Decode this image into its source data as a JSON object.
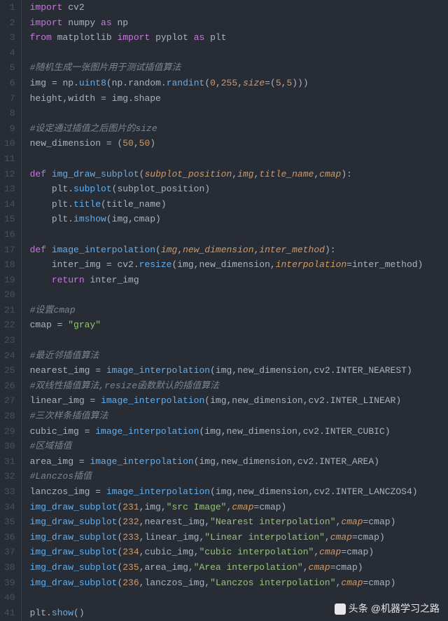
{
  "lines": [
    {
      "n": "1",
      "segs": [
        {
          "t": "import",
          "c": "kw"
        },
        {
          "t": " cv2",
          "c": "def"
        }
      ]
    },
    {
      "n": "2",
      "segs": [
        {
          "t": "import",
          "c": "kw"
        },
        {
          "t": " numpy ",
          "c": "def"
        },
        {
          "t": "as",
          "c": "kw"
        },
        {
          "t": " np",
          "c": "def"
        }
      ]
    },
    {
      "n": "3",
      "segs": [
        {
          "t": "from",
          "c": "kw"
        },
        {
          "t": " matplotlib ",
          "c": "def"
        },
        {
          "t": "import",
          "c": "kw"
        },
        {
          "t": " pyplot ",
          "c": "def"
        },
        {
          "t": "as",
          "c": "kw"
        },
        {
          "t": " plt",
          "c": "def"
        }
      ]
    },
    {
      "n": "4",
      "segs": []
    },
    {
      "n": "5",
      "segs": [
        {
          "t": "#随机生成一张图片用于测试插值算法",
          "c": "cmt"
        }
      ]
    },
    {
      "n": "6",
      "segs": [
        {
          "t": "img ",
          "c": "def"
        },
        {
          "t": "=",
          "c": "op"
        },
        {
          "t": " np.",
          "c": "def"
        },
        {
          "t": "uint8",
          "c": "fn"
        },
        {
          "t": "(np.random.",
          "c": "def"
        },
        {
          "t": "randint",
          "c": "fn"
        },
        {
          "t": "(",
          "c": "def"
        },
        {
          "t": "0",
          "c": "num"
        },
        {
          "t": ",",
          "c": "def"
        },
        {
          "t": "255",
          "c": "num"
        },
        {
          "t": ",",
          "c": "def"
        },
        {
          "t": "size",
          "c": "param"
        },
        {
          "t": "=",
          "c": "op"
        },
        {
          "t": "(",
          "c": "def"
        },
        {
          "t": "5",
          "c": "num"
        },
        {
          "t": ",",
          "c": "def"
        },
        {
          "t": "5",
          "c": "num"
        },
        {
          "t": ")))",
          "c": "def"
        }
      ]
    },
    {
      "n": "7",
      "segs": [
        {
          "t": "height,width ",
          "c": "def"
        },
        {
          "t": "=",
          "c": "op"
        },
        {
          "t": " img.shape",
          "c": "def"
        }
      ]
    },
    {
      "n": "8",
      "segs": []
    },
    {
      "n": "9",
      "segs": [
        {
          "t": "#设定通过插值之后图片的size",
          "c": "cmt"
        }
      ]
    },
    {
      "n": "10",
      "segs": [
        {
          "t": "new_dimension ",
          "c": "def"
        },
        {
          "t": "=",
          "c": "op"
        },
        {
          "t": " (",
          "c": "def"
        },
        {
          "t": "50",
          "c": "num"
        },
        {
          "t": ",",
          "c": "def"
        },
        {
          "t": "50",
          "c": "num"
        },
        {
          "t": ")",
          "c": "def"
        }
      ]
    },
    {
      "n": "11",
      "segs": []
    },
    {
      "n": "12",
      "segs": [
        {
          "t": "def",
          "c": "kw"
        },
        {
          "t": " ",
          "c": "def"
        },
        {
          "t": "img_draw_subplot",
          "c": "fn"
        },
        {
          "t": "(",
          "c": "def"
        },
        {
          "t": "subplot_position",
          "c": "param"
        },
        {
          "t": ",",
          "c": "def"
        },
        {
          "t": "img",
          "c": "param"
        },
        {
          "t": ",",
          "c": "def"
        },
        {
          "t": "title_name",
          "c": "param"
        },
        {
          "t": ",",
          "c": "def"
        },
        {
          "t": "cmap",
          "c": "param"
        },
        {
          "t": "):",
          "c": "def"
        }
      ]
    },
    {
      "n": "13",
      "segs": [
        {
          "t": "    plt.",
          "c": "def"
        },
        {
          "t": "subplot",
          "c": "fn"
        },
        {
          "t": "(subplot_position)",
          "c": "def"
        }
      ]
    },
    {
      "n": "14",
      "segs": [
        {
          "t": "    plt.",
          "c": "def"
        },
        {
          "t": "title",
          "c": "fn"
        },
        {
          "t": "(title_name)",
          "c": "def"
        }
      ]
    },
    {
      "n": "15",
      "segs": [
        {
          "t": "    plt.",
          "c": "def"
        },
        {
          "t": "imshow",
          "c": "fn"
        },
        {
          "t": "(img,cmap)",
          "c": "def"
        }
      ]
    },
    {
      "n": "16",
      "segs": []
    },
    {
      "n": "17",
      "segs": [
        {
          "t": "def",
          "c": "kw"
        },
        {
          "t": " ",
          "c": "def"
        },
        {
          "t": "image_interpolation",
          "c": "fn"
        },
        {
          "t": "(",
          "c": "def"
        },
        {
          "t": "img",
          "c": "param"
        },
        {
          "t": ",",
          "c": "def"
        },
        {
          "t": "new_dimension",
          "c": "param"
        },
        {
          "t": ",",
          "c": "def"
        },
        {
          "t": "inter_method",
          "c": "param"
        },
        {
          "t": "):",
          "c": "def"
        }
      ]
    },
    {
      "n": "18",
      "segs": [
        {
          "t": "    inter_img ",
          "c": "def"
        },
        {
          "t": "=",
          "c": "op"
        },
        {
          "t": " cv2.",
          "c": "def"
        },
        {
          "t": "resize",
          "c": "fn"
        },
        {
          "t": "(img,new_dimension,",
          "c": "def"
        },
        {
          "t": "interpolation",
          "c": "param"
        },
        {
          "t": "=",
          "c": "op"
        },
        {
          "t": "inter_method)",
          "c": "def"
        }
      ]
    },
    {
      "n": "19",
      "segs": [
        {
          "t": "    ",
          "c": "def"
        },
        {
          "t": "return",
          "c": "kw"
        },
        {
          "t": " inter_img",
          "c": "def"
        }
      ]
    },
    {
      "n": "20",
      "segs": []
    },
    {
      "n": "21",
      "segs": [
        {
          "t": "#设置cmap",
          "c": "cmt"
        }
      ]
    },
    {
      "n": "22",
      "segs": [
        {
          "t": "cmap ",
          "c": "def"
        },
        {
          "t": "=",
          "c": "op"
        },
        {
          "t": " ",
          "c": "def"
        },
        {
          "t": "\"gray\"",
          "c": "str"
        }
      ]
    },
    {
      "n": "23",
      "segs": []
    },
    {
      "n": "24",
      "segs": [
        {
          "t": "#最近邻插值算法",
          "c": "cmt"
        }
      ]
    },
    {
      "n": "25",
      "segs": [
        {
          "t": "nearest_img ",
          "c": "def"
        },
        {
          "t": "=",
          "c": "op"
        },
        {
          "t": " ",
          "c": "def"
        },
        {
          "t": "image_interpolation",
          "c": "fn"
        },
        {
          "t": "(img,new_dimension,cv2.INTER_NEAREST)",
          "c": "def"
        }
      ]
    },
    {
      "n": "26",
      "segs": [
        {
          "t": "#双线性插值算法,resize函数默认的插值算法",
          "c": "cmt"
        }
      ]
    },
    {
      "n": "27",
      "segs": [
        {
          "t": "linear_img ",
          "c": "def"
        },
        {
          "t": "=",
          "c": "op"
        },
        {
          "t": " ",
          "c": "def"
        },
        {
          "t": "image_interpolation",
          "c": "fn"
        },
        {
          "t": "(img,new_dimension,cv2.INTER_LINEAR)",
          "c": "def"
        }
      ]
    },
    {
      "n": "28",
      "segs": [
        {
          "t": "#三次样条插值算法",
          "c": "cmt"
        }
      ]
    },
    {
      "n": "29",
      "segs": [
        {
          "t": "cubic_img ",
          "c": "def"
        },
        {
          "t": "=",
          "c": "op"
        },
        {
          "t": " ",
          "c": "def"
        },
        {
          "t": "image_interpolation",
          "c": "fn"
        },
        {
          "t": "(img,new_dimension,cv2.INTER_CUBIC)",
          "c": "def"
        }
      ]
    },
    {
      "n": "30",
      "segs": [
        {
          "t": "#区域插值",
          "c": "cmt"
        }
      ]
    },
    {
      "n": "31",
      "segs": [
        {
          "t": "area_img ",
          "c": "def"
        },
        {
          "t": "=",
          "c": "op"
        },
        {
          "t": " ",
          "c": "def"
        },
        {
          "t": "image_interpolation",
          "c": "fn"
        },
        {
          "t": "(img,new_dimension,cv2.INTER_AREA)",
          "c": "def"
        }
      ]
    },
    {
      "n": "32",
      "segs": [
        {
          "t": "#Lanczos插值",
          "c": "cmt"
        }
      ]
    },
    {
      "n": "33",
      "segs": [
        {
          "t": "lanczos_img ",
          "c": "def"
        },
        {
          "t": "=",
          "c": "op"
        },
        {
          "t": " ",
          "c": "def"
        },
        {
          "t": "image_interpolation",
          "c": "fn"
        },
        {
          "t": "(img,new_dimension,cv2.INTER_LANCZOS4)",
          "c": "def"
        }
      ]
    },
    {
      "n": "34",
      "segs": [
        {
          "t": "img_draw_subplot",
          "c": "fn"
        },
        {
          "t": "(",
          "c": "def"
        },
        {
          "t": "231",
          "c": "num"
        },
        {
          "t": ",img,",
          "c": "def"
        },
        {
          "t": "\"src Image\"",
          "c": "str"
        },
        {
          "t": ",",
          "c": "def"
        },
        {
          "t": "cmap",
          "c": "param"
        },
        {
          "t": "=",
          "c": "op"
        },
        {
          "t": "cmap)",
          "c": "def"
        }
      ]
    },
    {
      "n": "35",
      "segs": [
        {
          "t": "img_draw_subplot",
          "c": "fn"
        },
        {
          "t": "(",
          "c": "def"
        },
        {
          "t": "232",
          "c": "num"
        },
        {
          "t": ",nearest_img,",
          "c": "def"
        },
        {
          "t": "\"Nearest interpolation\"",
          "c": "str"
        },
        {
          "t": ",",
          "c": "def"
        },
        {
          "t": "cmap",
          "c": "param"
        },
        {
          "t": "=",
          "c": "op"
        },
        {
          "t": "cmap)",
          "c": "def"
        }
      ]
    },
    {
      "n": "36",
      "segs": [
        {
          "t": "img_draw_subplot",
          "c": "fn"
        },
        {
          "t": "(",
          "c": "def"
        },
        {
          "t": "233",
          "c": "num"
        },
        {
          "t": ",linear_img,",
          "c": "def"
        },
        {
          "t": "\"Linear interpolation\"",
          "c": "str"
        },
        {
          "t": ",",
          "c": "def"
        },
        {
          "t": "cmap",
          "c": "param"
        },
        {
          "t": "=",
          "c": "op"
        },
        {
          "t": "cmap)",
          "c": "def"
        }
      ]
    },
    {
      "n": "37",
      "segs": [
        {
          "t": "img_draw_subplot",
          "c": "fn"
        },
        {
          "t": "(",
          "c": "def"
        },
        {
          "t": "234",
          "c": "num"
        },
        {
          "t": ",cubic_img,",
          "c": "def"
        },
        {
          "t": "\"cubic interpolation\"",
          "c": "str"
        },
        {
          "t": ",",
          "c": "def"
        },
        {
          "t": "cmap",
          "c": "param"
        },
        {
          "t": "=",
          "c": "op"
        },
        {
          "t": "cmap)",
          "c": "def"
        }
      ]
    },
    {
      "n": "38",
      "segs": [
        {
          "t": "img_draw_subplot",
          "c": "fn"
        },
        {
          "t": "(",
          "c": "def"
        },
        {
          "t": "235",
          "c": "num"
        },
        {
          "t": ",area_img,",
          "c": "def"
        },
        {
          "t": "\"Area interpolation\"",
          "c": "str"
        },
        {
          "t": ",",
          "c": "def"
        },
        {
          "t": "cmap",
          "c": "param"
        },
        {
          "t": "=",
          "c": "op"
        },
        {
          "t": "cmap)",
          "c": "def"
        }
      ]
    },
    {
      "n": "39",
      "segs": [
        {
          "t": "img_draw_subplot",
          "c": "fn"
        },
        {
          "t": "(",
          "c": "def"
        },
        {
          "t": "236",
          "c": "num"
        },
        {
          "t": ",lanczos_img,",
          "c": "def"
        },
        {
          "t": "\"Lanczos interpolation\"",
          "c": "str"
        },
        {
          "t": ",",
          "c": "def"
        },
        {
          "t": "cmap",
          "c": "param"
        },
        {
          "t": "=",
          "c": "op"
        },
        {
          "t": "cmap)",
          "c": "def"
        }
      ]
    },
    {
      "n": "40",
      "segs": []
    },
    {
      "n": "41",
      "segs": [
        {
          "t": "plt.",
          "c": "def"
        },
        {
          "t": "show",
          "c": "fn"
        },
        {
          "t": "()",
          "c": "def"
        }
      ]
    }
  ],
  "watermark": {
    "prefix": "头条",
    "handle": "@机器学习之路"
  }
}
